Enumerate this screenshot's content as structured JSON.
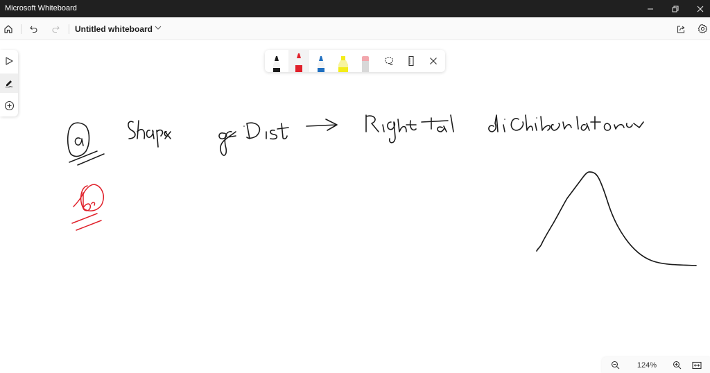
{
  "window": {
    "app_title": "Microsoft Whiteboard",
    "controls": {
      "minimize": "minimize",
      "restore": "restore",
      "close": "close"
    }
  },
  "header": {
    "board_title": "Untitled whiteboard",
    "icons": [
      "home-icon",
      "undo-icon",
      "redo-icon",
      "chevron-down-icon",
      "share-icon",
      "gear-icon"
    ]
  },
  "left_toolbar": {
    "items": [
      {
        "name": "select",
        "icon": "pointer-icon",
        "active": false
      },
      {
        "name": "inking",
        "icon": "pen-icon",
        "active": true
      },
      {
        "name": "add",
        "icon": "plus-circle-icon",
        "active": false
      }
    ]
  },
  "ink_toolbar": {
    "tools": [
      {
        "name": "black-pen",
        "color": "#1a1a1a",
        "selected": false
      },
      {
        "name": "red-pen",
        "color": "#e0202a",
        "selected": true
      },
      {
        "name": "blue-pen",
        "color": "#1f6fc0",
        "selected": false
      },
      {
        "name": "yellow-highlighter",
        "color": "#f3ec1a",
        "selected": false
      },
      {
        "name": "eraser",
        "color": "#f2a7ad",
        "selected": false
      }
    ],
    "controls": [
      "lasso-icon",
      "ruler-icon",
      "close-icon"
    ]
  },
  "canvas": {
    "ink_text": {
      "label_a": "@",
      "line1": "Shape of Dist",
      "arrow": "->",
      "line1_answer": "Right tail distribution",
      "label_b": "b"
    },
    "ink_colors": {
      "black": "#1c1c1c",
      "red": "#e0202a"
    },
    "sketch": "right-skewed distribution curve"
  },
  "zoom": {
    "level": "124%"
  }
}
